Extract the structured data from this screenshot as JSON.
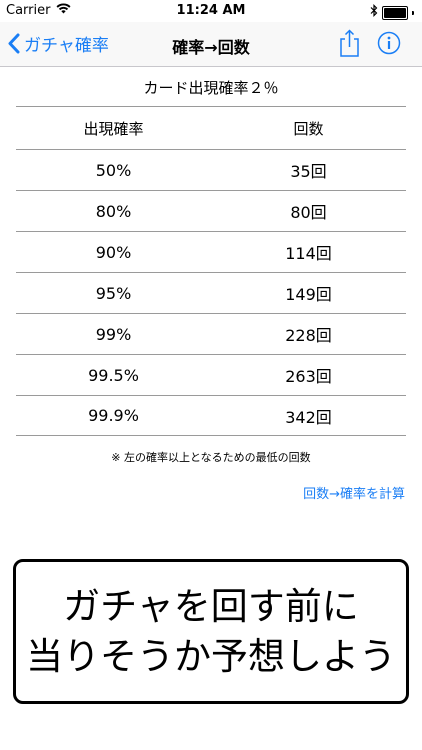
{
  "status_bar": {
    "carrier": "Carrier",
    "time": "11:24 AM"
  },
  "nav": {
    "back_label": "ガチャ確率",
    "title": "確率→回数",
    "share_icon": "share-icon",
    "info_icon": "info-icon"
  },
  "subtitle": "カード出現確率２％",
  "table": {
    "headers": [
      "出現確率",
      "回数"
    ],
    "rows": [
      [
        "50%",
        "35回"
      ],
      [
        "80%",
        "80回"
      ],
      [
        "90%",
        "114回"
      ],
      [
        "95%",
        "149回"
      ],
      [
        "99%",
        "228回"
      ],
      [
        "99.5%",
        "263回"
      ],
      [
        "99.9%",
        "342回"
      ]
    ]
  },
  "note": "※ 左の確率以上となるための最低の回数",
  "calc_link": "回数→確率を計算",
  "promo": {
    "line1": "ガチャを回す前に",
    "line2": "当りそうか予想しよう"
  },
  "colors": {
    "accent": "#1a7ef5",
    "divider": "#9a9a9a"
  }
}
